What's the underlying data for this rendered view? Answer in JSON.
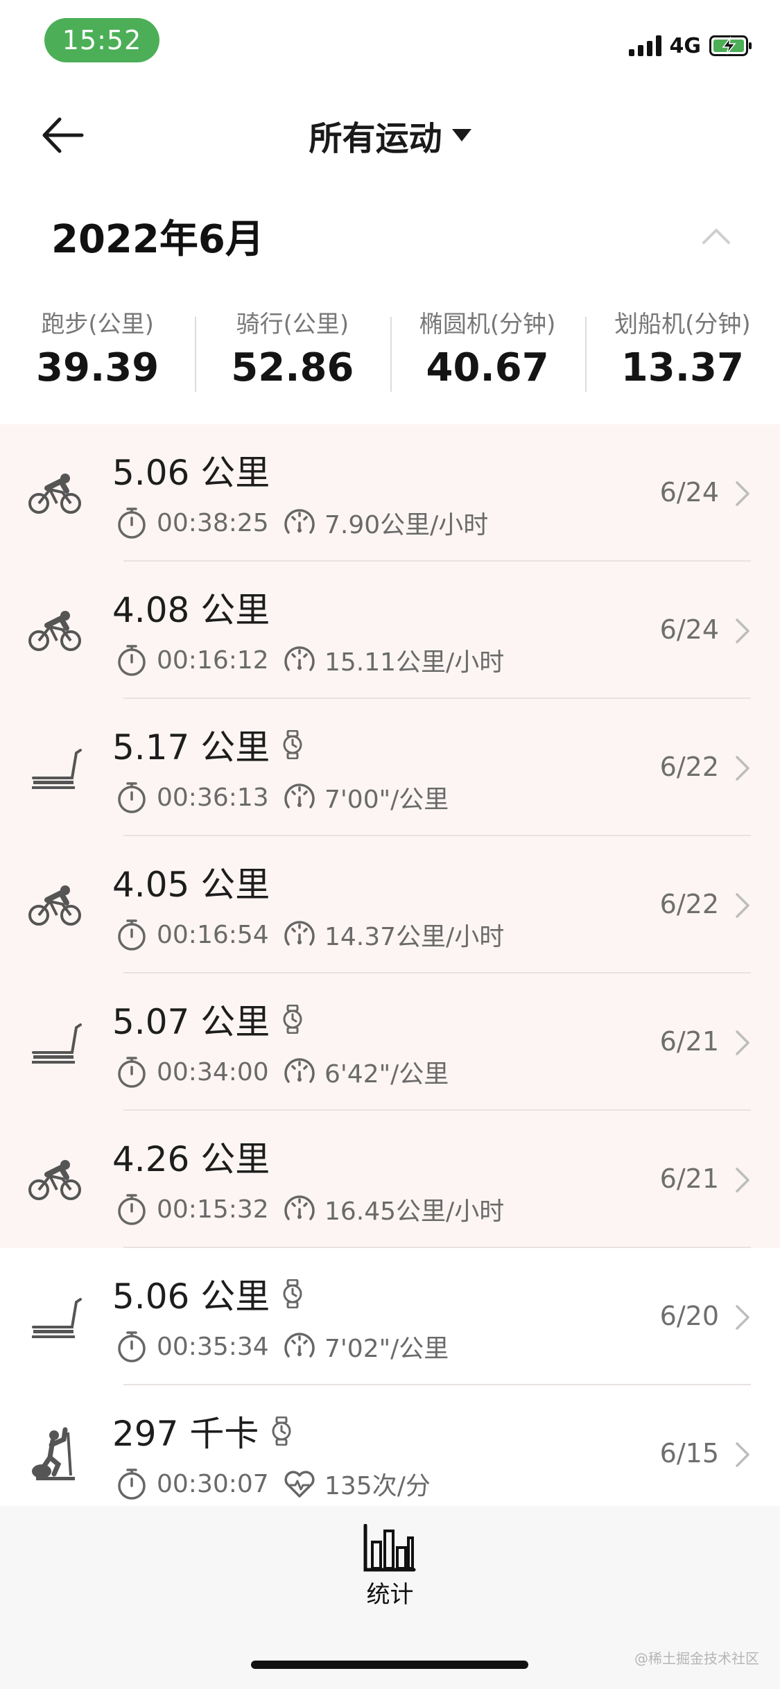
{
  "status": {
    "time": "15:52",
    "network": "4G"
  },
  "header": {
    "title": "所有运动"
  },
  "month": "2022年6月",
  "summary": [
    {
      "label": "跑步(公里)",
      "value": "39.39"
    },
    {
      "label": "骑行(公里)",
      "value": "52.86"
    },
    {
      "label": "椭圆机(分钟)",
      "value": "40.67"
    },
    {
      "label": "划船机(分钟)",
      "value": "13.37"
    }
  ],
  "workouts": [
    {
      "type": "cycling",
      "metric": "5.06 公里",
      "watch": false,
      "duration": "00:38:25",
      "stat_kind": "speed",
      "stat": "7.90公里/小时",
      "date": "6/24",
      "highlight": true
    },
    {
      "type": "cycling",
      "metric": "4.08 公里",
      "watch": false,
      "duration": "00:16:12",
      "stat_kind": "speed",
      "stat": "15.11公里/小时",
      "date": "6/24",
      "highlight": true
    },
    {
      "type": "treadmill",
      "metric": "5.17 公里",
      "watch": true,
      "duration": "00:36:13",
      "stat_kind": "speed",
      "stat": "7'00\"/公里",
      "date": "6/22",
      "highlight": true
    },
    {
      "type": "cycling",
      "metric": "4.05 公里",
      "watch": false,
      "duration": "00:16:54",
      "stat_kind": "speed",
      "stat": "14.37公里/小时",
      "date": "6/22",
      "highlight": true
    },
    {
      "type": "treadmill",
      "metric": "5.07 公里",
      "watch": true,
      "duration": "00:34:00",
      "stat_kind": "speed",
      "stat": "6'42\"/公里",
      "date": "6/21",
      "highlight": true
    },
    {
      "type": "cycling",
      "metric": "4.26 公里",
      "watch": false,
      "duration": "00:15:32",
      "stat_kind": "speed",
      "stat": "16.45公里/小时",
      "date": "6/21",
      "highlight": true
    },
    {
      "type": "treadmill",
      "metric": "5.06 公里",
      "watch": true,
      "duration": "00:35:34",
      "stat_kind": "speed",
      "stat": "7'02\"/公里",
      "date": "6/20",
      "highlight": false
    },
    {
      "type": "elliptical",
      "metric": "297 千卡",
      "watch": true,
      "duration": "00:30:07",
      "stat_kind": "heart",
      "stat": "135次/分",
      "date": "6/15",
      "highlight": false
    }
  ],
  "tabbar": {
    "label": "统计"
  },
  "watermark": "@稀土掘金技术社区",
  "colors": {
    "status_green": "#4caf57",
    "highlight_bg": "#fcf5f3",
    "tab_bg": "#f7f7f7"
  },
  "icons": {
    "cycling": "cycling-icon",
    "treadmill": "treadmill-icon",
    "elliptical": "elliptical-icon",
    "watch": "watch-icon",
    "duration": "stopwatch-icon",
    "speed": "speedometer-icon",
    "heart": "heart-rate-icon"
  }
}
